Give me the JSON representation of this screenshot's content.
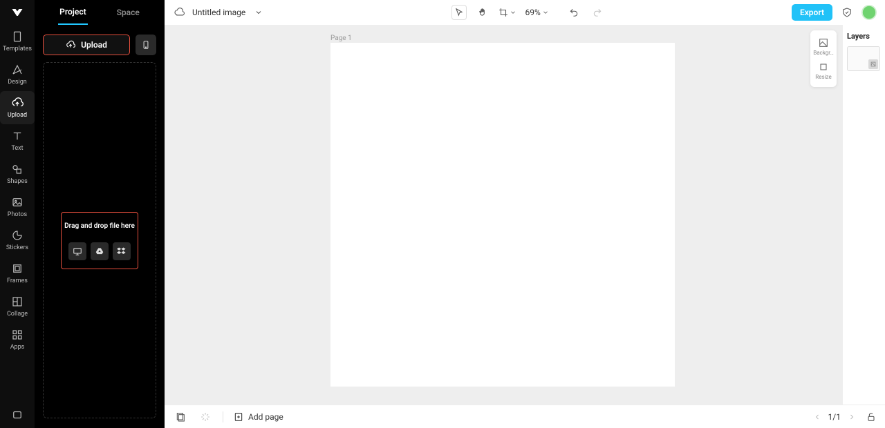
{
  "rail": {
    "items": [
      {
        "label": "Templates"
      },
      {
        "label": "Design"
      },
      {
        "label": "Upload"
      },
      {
        "label": "Text"
      },
      {
        "label": "Shapes"
      },
      {
        "label": "Photos"
      },
      {
        "label": "Stickers"
      },
      {
        "label": "Frames"
      },
      {
        "label": "Collage"
      },
      {
        "label": "Apps"
      }
    ],
    "active_index": 2
  },
  "panel": {
    "tabs": {
      "project": "Project",
      "space": "Space",
      "active": "project"
    },
    "upload_label": "Upload",
    "drop_text": "Drag and drop file here"
  },
  "topbar": {
    "doc_title": "Untitled image",
    "zoom": "69%",
    "export_label": "Export"
  },
  "canvas": {
    "page_label": "Page 1",
    "floating": {
      "background": "Backgr…",
      "resize": "Resize"
    }
  },
  "layers": {
    "title": "Layers"
  },
  "bottombar": {
    "add_page": "Add page",
    "pager": "1/1"
  }
}
